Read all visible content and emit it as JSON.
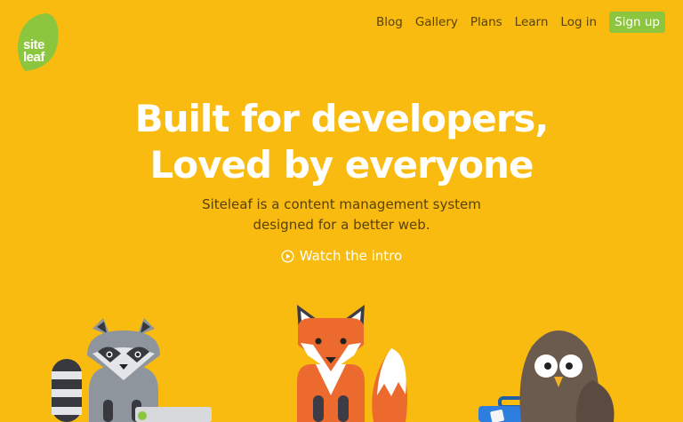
{
  "logo": {
    "line1": "site",
    "line2": "leaf"
  },
  "nav": {
    "items": [
      "Blog",
      "Gallery",
      "Plans",
      "Learn",
      "Log in"
    ],
    "signup": "Sign up"
  },
  "hero": {
    "title_line1": "Built for developers,",
    "title_line2": "Loved by everyone",
    "subtitle_line1": "Siteleaf is a content management system",
    "subtitle_line2": "designed for a better web.",
    "watch": "Watch the intro"
  },
  "colors": {
    "background": "#f9bb10",
    "accent_green": "#8cc63f",
    "text_dark": "#5a4206"
  }
}
